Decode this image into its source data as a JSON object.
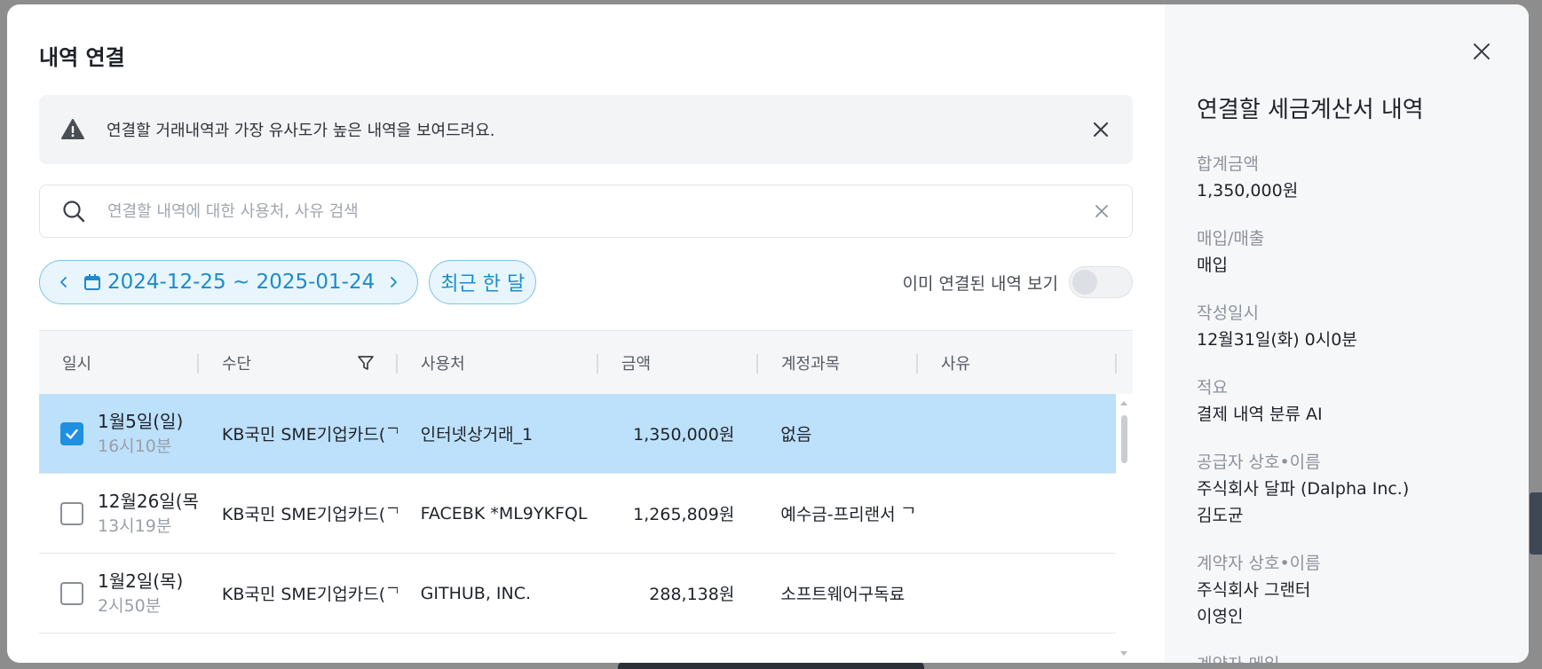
{
  "modal": {
    "title": "내역 연결"
  },
  "alert": {
    "text": "연결할 거래내역과 가장 유사도가 높은 내역을 보여드려요."
  },
  "search": {
    "placeholder": "연결할 내역에 대한 사용처, 사유 검색",
    "value": ""
  },
  "filters": {
    "date_range": "2024-12-25 ~ 2025-01-24",
    "recent_month_label": "최근 한 달",
    "show_linked_label": "이미 연결된 내역 보기",
    "show_linked_on": false
  },
  "table": {
    "headers": [
      "일시",
      "수단",
      "사용처",
      "금액",
      "계정과목",
      "사유"
    ],
    "rows": [
      {
        "date": "1월5일(일)",
        "time": "16시10분",
        "method": "KB국민 SME기업카드(ᄀ",
        "merchant": "인터넷상거래_1",
        "amount": "1,350,000원",
        "account": "없음",
        "reason": "",
        "checked": true
      },
      {
        "date": "12월26일(목)",
        "time": "13시19분",
        "method": "KB국민 SME기업카드(ᄀ",
        "merchant": "FACEBK *ML9YKFQL",
        "amount": "1,265,809원",
        "account": "예수금-프리랜서 ᄀ",
        "reason": "",
        "checked": false
      },
      {
        "date": "1월2일(목)",
        "time": "2시50분",
        "method": "KB국민 SME기업카드(ᄀ",
        "merchant": "GITHUB, INC.",
        "amount": "288,138원",
        "account": "소프트웨어구독료",
        "reason": "",
        "checked": false
      }
    ]
  },
  "side": {
    "title": "연결할 세금계산서 내역",
    "fields": [
      {
        "label": "합계금액",
        "value": "1,350,000원"
      },
      {
        "label": "매입/매출",
        "value": "매입"
      },
      {
        "label": "작성일시",
        "value": "12월31일(화) 0시0분"
      },
      {
        "label": "적요",
        "value": "결제 내역 분류 AI"
      },
      {
        "label": "공급자 상호•이름",
        "value": "주식회사 달파 (Dalpha Inc.)",
        "value2": "김도균"
      },
      {
        "label": "계약자 상호•이름",
        "value": "주식회사 그랜터",
        "value2": "이영인"
      },
      {
        "label": "계약자 메일",
        "value": ""
      }
    ]
  },
  "colors": {
    "accent": "#1a8ccc",
    "selected_row": "#bde0fb",
    "checkbox_checked": "#1f8fe0"
  }
}
